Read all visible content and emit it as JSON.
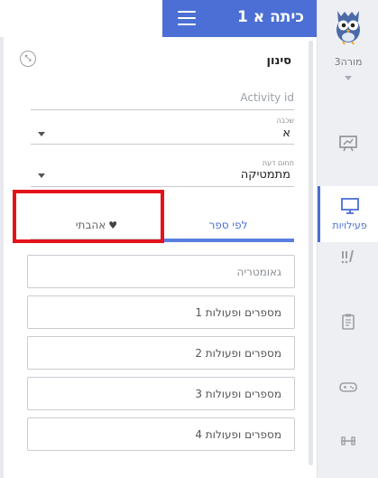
{
  "header": {
    "title": "כיתה א 1",
    "menu_icon": "hamburger-icon"
  },
  "filter": {
    "title": "סינון",
    "collapse_icon": "collapse-arrows-icon",
    "activity_id_placeholder": "Activity id",
    "grade": {
      "label": "שכבה",
      "value": "א"
    },
    "subject": {
      "label": "תחום דעת",
      "value": "מתמטיקה"
    }
  },
  "tabs": {
    "books": "לפי ספר",
    "liked": "אהבתי"
  },
  "books": [
    "גאומטריה",
    "מספרים ופעולות 1",
    "מספרים ופעולות 2",
    "מספרים ופעולות 3",
    "מספרים ופעולות 4"
  ],
  "sidebar": {
    "teacher_name": "מורה3",
    "activities_label": "פעילויות"
  },
  "colors": {
    "accent": "#4b6fd4",
    "highlight": "#e4131b"
  }
}
